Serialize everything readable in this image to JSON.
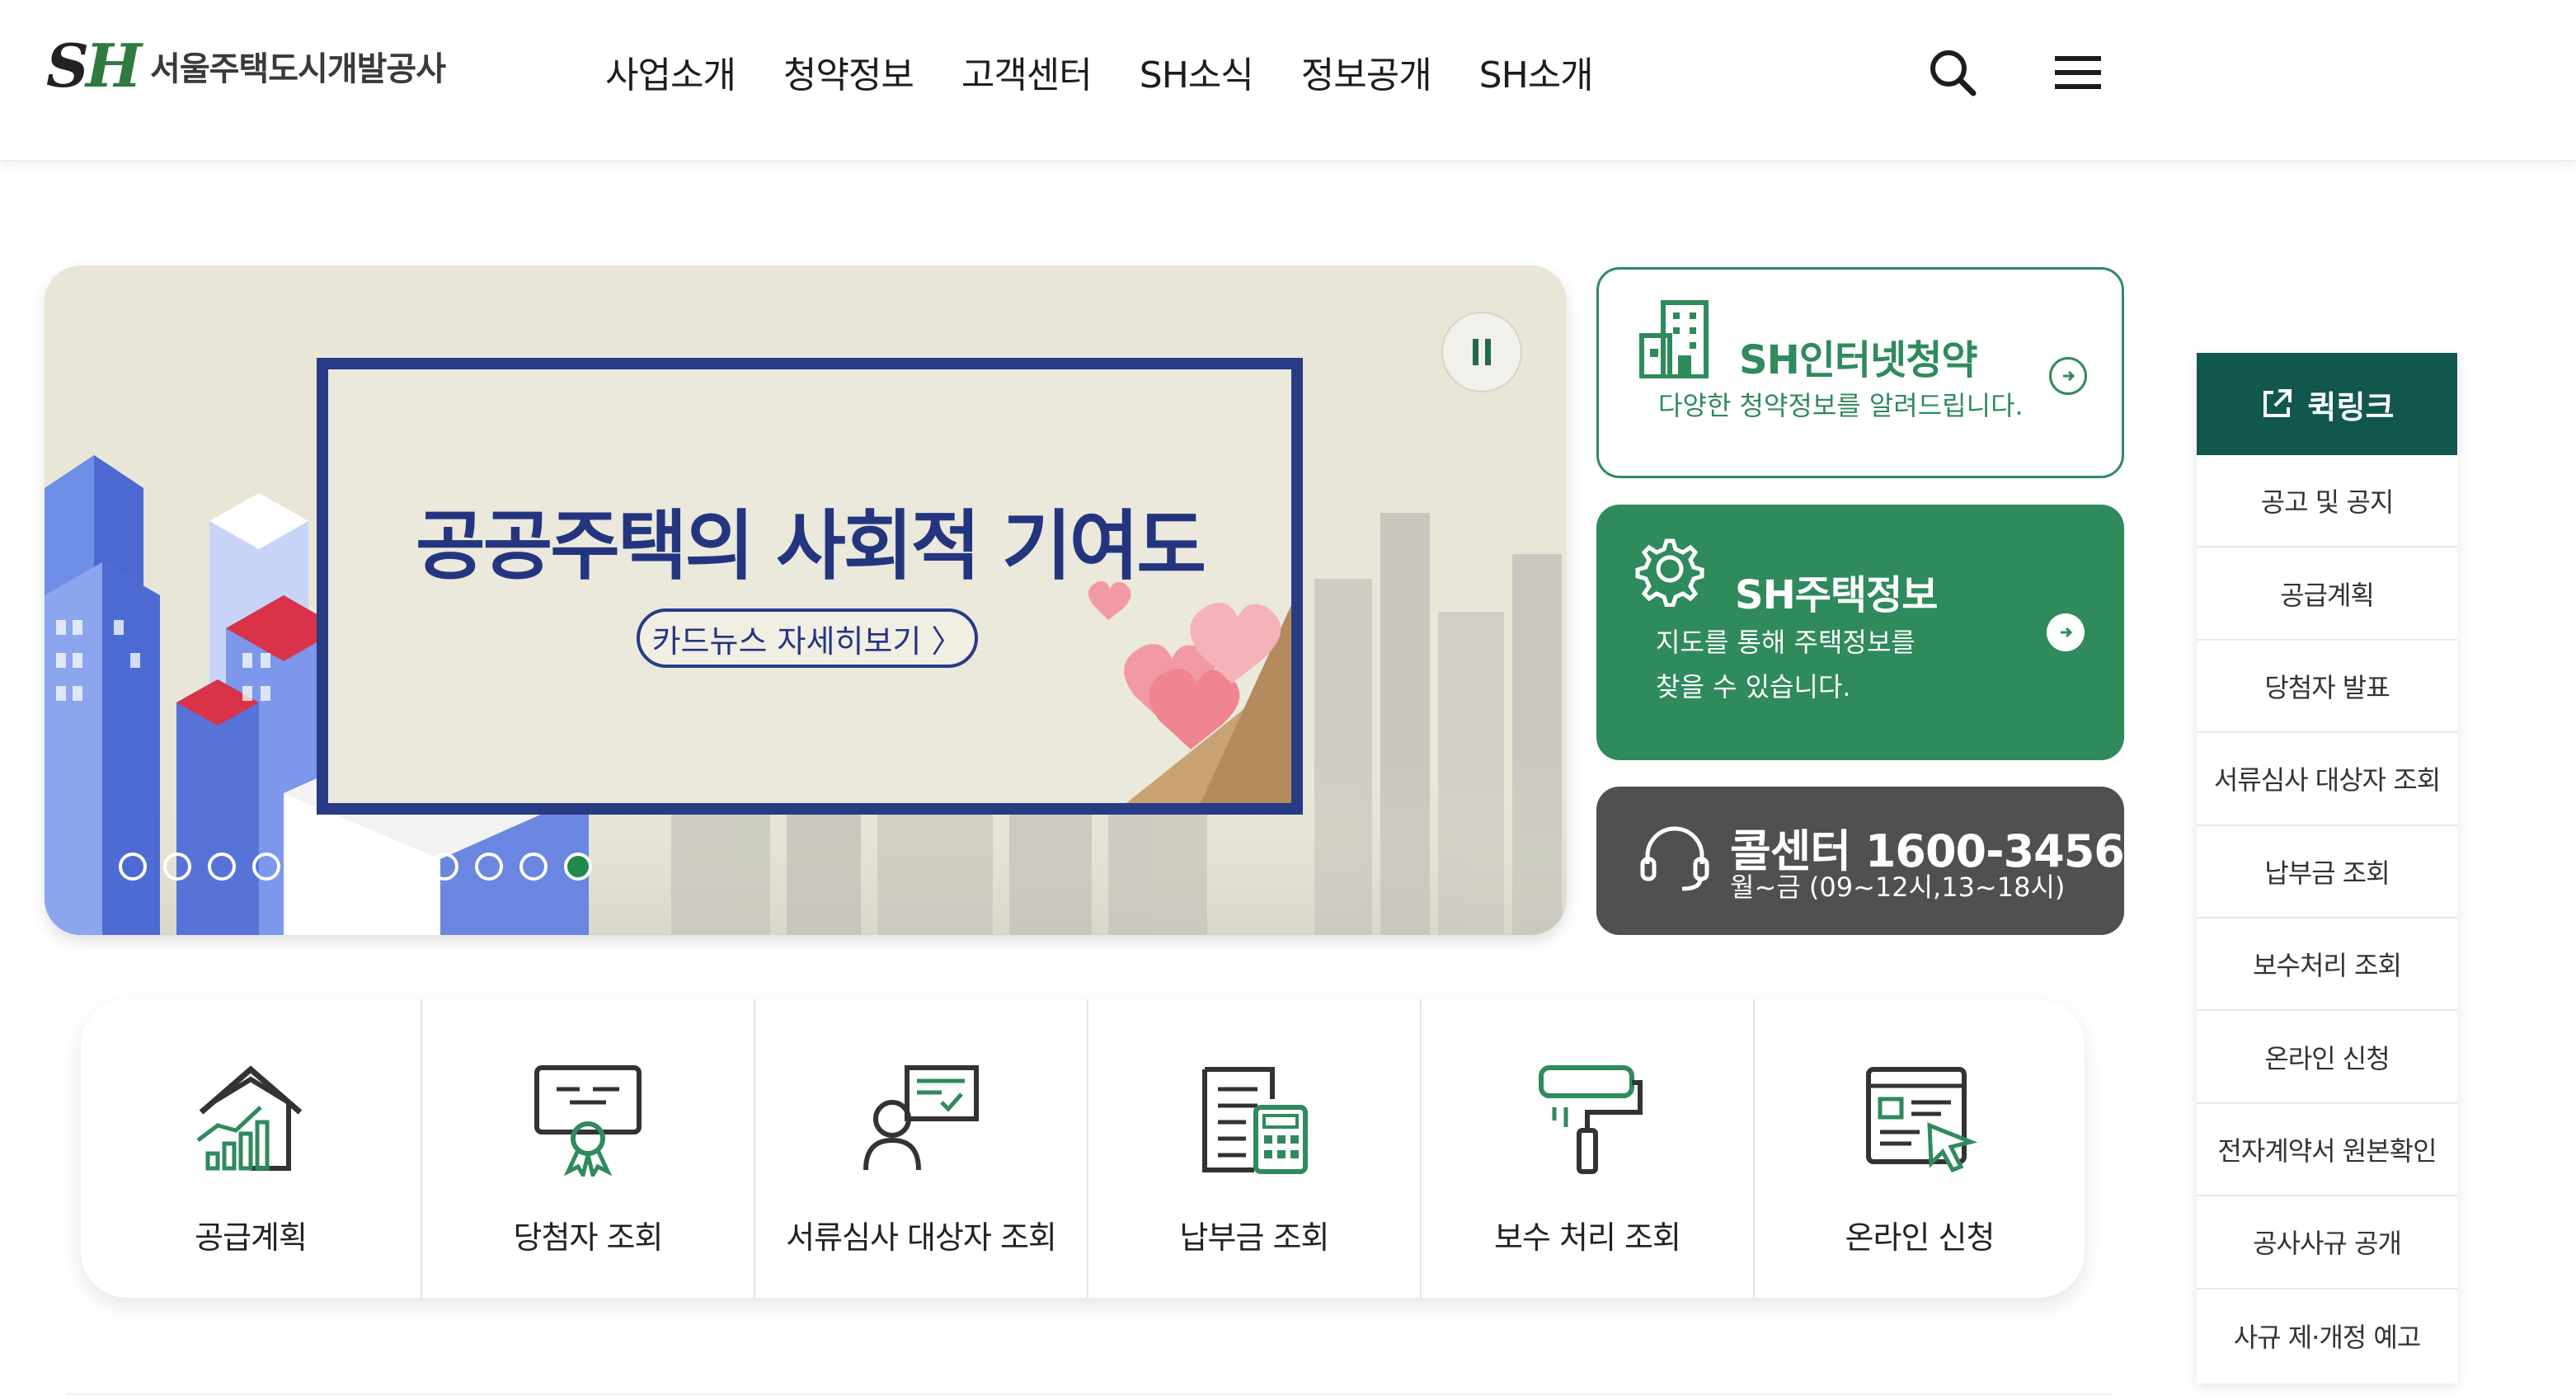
{
  "colors": {
    "brand_green": "#2f8a5c",
    "navy": "#283b85",
    "dark_teal": "#11574e",
    "call_gray": "#505050"
  },
  "header": {
    "logo_mark": "SH",
    "logo_text": "서울주택도시개발공사",
    "nav": [
      "사업소개",
      "청약정보",
      "고객센터",
      "SH소식",
      "정보공개",
      "SH소개"
    ],
    "search_icon": "search-icon",
    "menu_icon": "hamburger-menu-icon"
  },
  "hero": {
    "title": "공공주택의 사회적 기여도",
    "link_label": "카드뉴스 자세히보기 〉",
    "pause_icon": "pause-icon",
    "slide_count": 11,
    "active_slide": 11
  },
  "quick_cards": {
    "apply": {
      "title": "SH인터넷청약",
      "desc": "다양한 청약정보를 알려드립니다."
    },
    "housing": {
      "title": "SH주택정보",
      "desc_line1": "지도를 통해 주택정보를",
      "desc_line2": "찾을 수 있습니다."
    },
    "call": {
      "title": "콜센터 1600-3456",
      "hours": "월~금 (09~12시,13~18시)"
    }
  },
  "quicklink": {
    "title": "퀵링크",
    "items": [
      "공고 및 공지",
      "공급계획",
      "당첨자 발표",
      "서류심사 대상자 조회",
      "납부금 조회",
      "보수처리 조회",
      "온라인 신청",
      "전자계약서 원본확인",
      "공사사규 공개",
      "사규 제·개정 예고"
    ]
  },
  "services": [
    {
      "label": "공급계획",
      "icon": "house-chart-icon"
    },
    {
      "label": "당첨자 조회",
      "icon": "certificate-icon"
    },
    {
      "label": "서류심사 대상자 조회",
      "icon": "person-document-icon"
    },
    {
      "label": "납부금 조회",
      "icon": "calculator-document-icon"
    },
    {
      "label": "보수 처리 조회",
      "icon": "paint-roller-icon"
    },
    {
      "label": "온라인 신청",
      "icon": "online-form-icon"
    }
  ]
}
